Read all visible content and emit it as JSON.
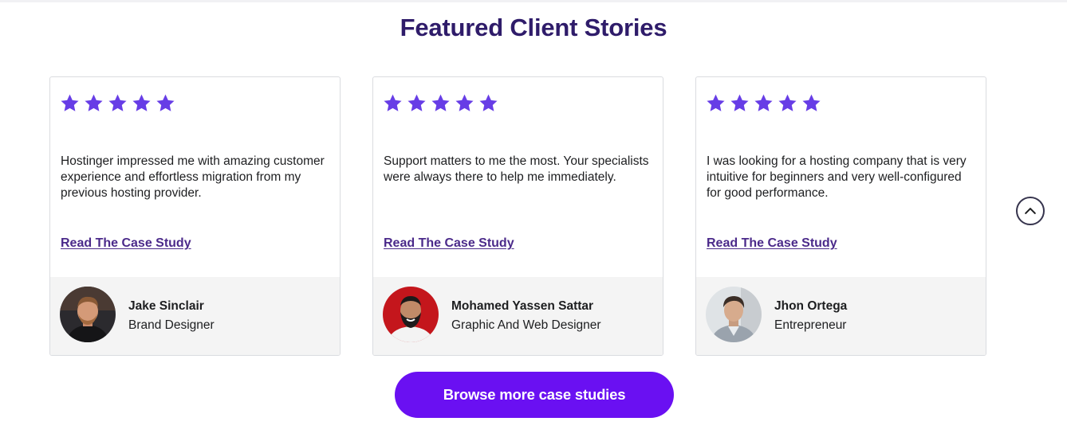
{
  "section": {
    "title": "Featured Client Stories"
  },
  "colors": {
    "star": "#673de6",
    "title": "#2f1c6a",
    "link": "#4b2a8a",
    "button": "#6a10f2"
  },
  "testimonials": [
    {
      "rating": 5,
      "quote": "Hostinger impressed me with amazing customer experience and effortless migration from my previous hosting provider.",
      "link_label": "Read The Case Study",
      "name": "Jake Sinclair",
      "role": "Brand Designer"
    },
    {
      "rating": 5,
      "quote": "Support matters to me the most. Your specialists were always there to help me immediately.",
      "link_label": "Read The Case Study",
      "name": "Mohamed Yassen Sattar",
      "role": "Graphic And Web Designer"
    },
    {
      "rating": 5,
      "quote": "I was looking for a hosting company that is very intuitive for beginners and very well-configured for good performance.",
      "link_label": "Read The Case Study",
      "name": "Jhon Ortega",
      "role": "Entrepreneur"
    }
  ],
  "scroll_top_icon": "chevron-up-icon",
  "cta": {
    "label": "Browse more case studies"
  }
}
